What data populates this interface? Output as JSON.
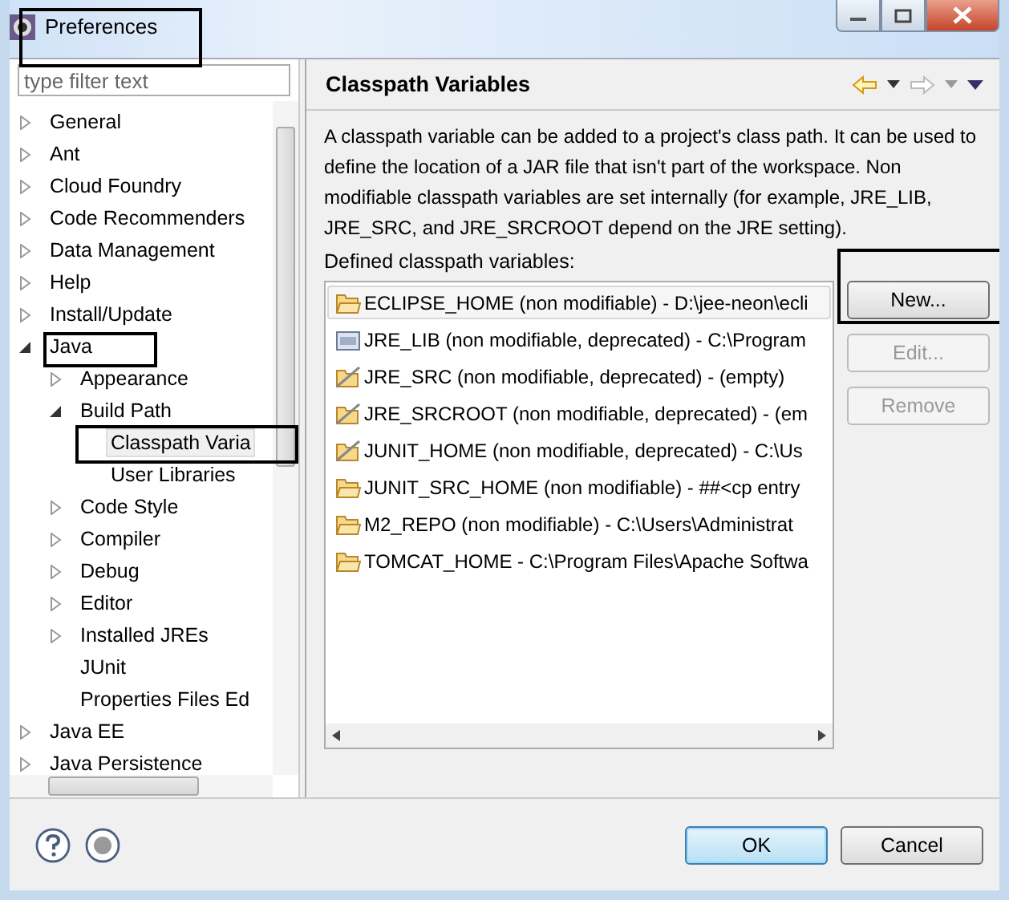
{
  "window": {
    "title": "Preferences"
  },
  "filter": {
    "placeholder": "type filter text"
  },
  "tree": [
    {
      "label": "General",
      "expanded": false,
      "selected": false
    },
    {
      "label": "Ant",
      "expanded": false,
      "selected": false
    },
    {
      "label": "Cloud Foundry",
      "expanded": false,
      "selected": false
    },
    {
      "label": "Code Recommenders",
      "expanded": false,
      "selected": false
    },
    {
      "label": "Data Management",
      "expanded": false,
      "selected": false
    },
    {
      "label": "Help",
      "expanded": false,
      "selected": false
    },
    {
      "label": "Install/Update",
      "expanded": false,
      "selected": false
    },
    {
      "label": "Java",
      "expanded": true,
      "selected": false,
      "children": [
        {
          "label": "Appearance",
          "expanded": false,
          "selected": false
        },
        {
          "label": "Build Path",
          "expanded": true,
          "selected": false,
          "children": [
            {
              "label": "Classpath Varia",
              "selected": true
            },
            {
              "label": "User Libraries",
              "selected": false
            }
          ]
        },
        {
          "label": "Code Style",
          "expanded": false,
          "selected": false
        },
        {
          "label": "Compiler",
          "expanded": false,
          "selected": false
        },
        {
          "label": "Debug",
          "expanded": false,
          "selected": false
        },
        {
          "label": "Editor",
          "expanded": false,
          "selected": false
        },
        {
          "label": "Installed JREs",
          "expanded": false,
          "selected": false
        },
        {
          "label": "JUnit",
          "selected": false
        },
        {
          "label": "Properties Files Ed",
          "selected": false
        }
      ]
    },
    {
      "label": "Java EE",
      "expanded": false,
      "selected": false
    },
    {
      "label": "Java Persistence",
      "expanded": false,
      "selected": false
    }
  ],
  "page": {
    "title": "Classpath Variables",
    "description": "A classpath variable can be added to a project's class path. It can be used to define the location of a JAR file that isn't part of the workspace. Non modifiable classpath variables are set internally (for example, JRE_LIB, JRE_SRC, and JRE_SRCROOT depend on the JRE setting).",
    "list_label": "Defined classpath variables:",
    "variables": [
      {
        "kind": "folder",
        "text": "ECLIPSE_HOME (non modifiable) - D:\\jee-neon\\ecli",
        "selected": true
      },
      {
        "kind": "jar",
        "text": "JRE_LIB (non modifiable, deprecated) - C:\\Program",
        "selected": false
      },
      {
        "kind": "deprecated",
        "text": "JRE_SRC (non modifiable, deprecated) - (empty)",
        "selected": false
      },
      {
        "kind": "deprecated",
        "text": "JRE_SRCROOT (non modifiable, deprecated) - (em",
        "selected": false
      },
      {
        "kind": "deprecated",
        "text": "JUNIT_HOME (non modifiable, deprecated) - C:\\Us",
        "selected": false
      },
      {
        "kind": "folder",
        "text": "JUNIT_SRC_HOME (non modifiable) - ##<cp entry",
        "selected": false
      },
      {
        "kind": "folder",
        "text": "M2_REPO (non modifiable) - C:\\Users\\Administrat",
        "selected": false
      },
      {
        "kind": "folder",
        "text": "TOMCAT_HOME - C:\\Program Files\\Apache Softwa",
        "selected": false
      }
    ],
    "side_buttons": [
      {
        "label": "New...",
        "disabled": false
      },
      {
        "label": "Edit...",
        "disabled": true
      },
      {
        "label": "Remove",
        "disabled": true
      }
    ]
  },
  "buttons": [
    {
      "label": "OK",
      "default": true
    },
    {
      "label": "Cancel",
      "default": false
    }
  ]
}
